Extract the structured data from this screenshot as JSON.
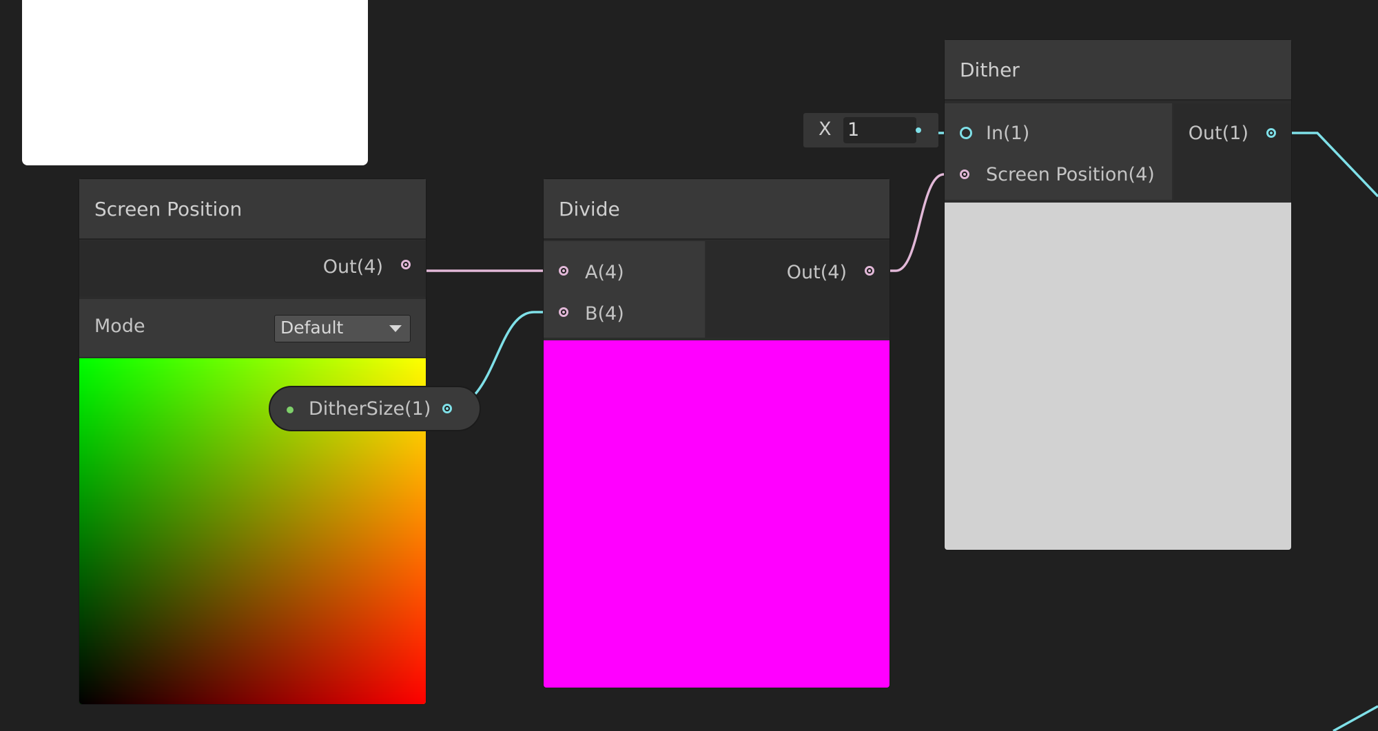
{
  "nodes": {
    "screen_position": {
      "title": "Screen Position",
      "output_label": "Out(4)",
      "mode_label": "Mode",
      "mode_value": "Default"
    },
    "divide": {
      "title": "Divide",
      "input_a": "A(4)",
      "input_b": "B(4)",
      "output_label": "Out(4)"
    },
    "dither": {
      "title": "Dither",
      "input_in": "In(1)",
      "input_screen": "Screen Position(4)",
      "output_label": "Out(1)"
    }
  },
  "property": {
    "label": "DitherSize(1)"
  },
  "inline_input": {
    "axis_label": "X",
    "value": "1"
  },
  "colors": {
    "background": "#202020",
    "vector4_wire": "#e2b8d8",
    "float_wire": "#7fe0e8",
    "divide_preview": "#ff00ff",
    "dither_preview": "#d2d2d2"
  },
  "icons": {
    "dropdown": "triangle-down-icon"
  }
}
